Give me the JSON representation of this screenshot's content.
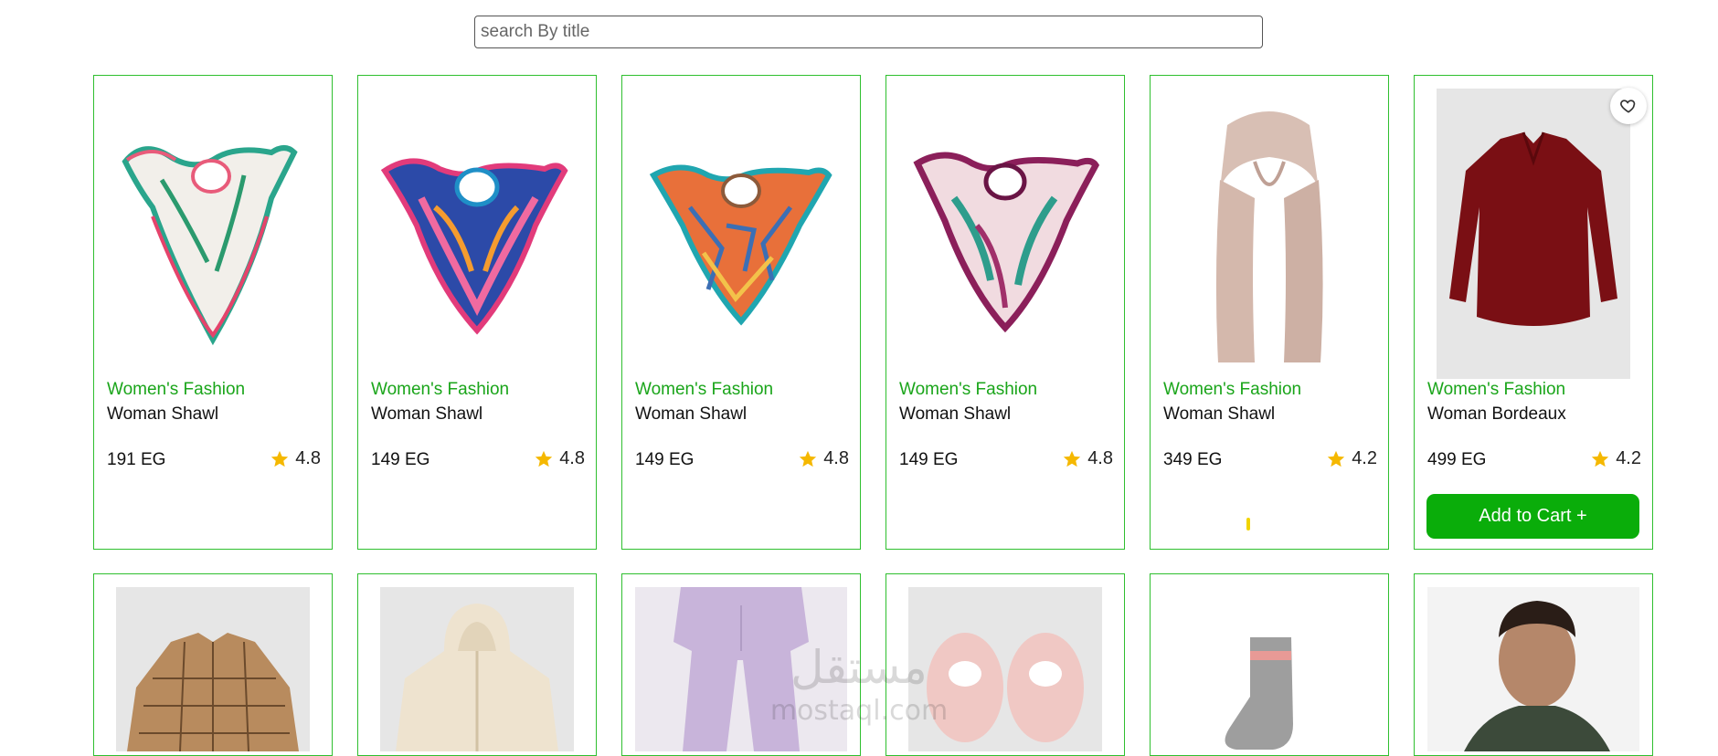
{
  "search": {
    "placeholder": "search By title"
  },
  "products": [
    {
      "category": "Women's Fashion",
      "title": "Woman Shawl",
      "price": "191 EG",
      "rating": "4.8",
      "image": "floral-white-scarf"
    },
    {
      "category": "Women's Fashion",
      "title": "Woman Shawl",
      "price": "149 EG",
      "rating": "4.8",
      "image": "blue-pink-scarf"
    },
    {
      "category": "Women's Fashion",
      "title": "Woman Shawl",
      "price": "149 EG",
      "rating": "4.8",
      "image": "orange-teal-scarf"
    },
    {
      "category": "Women's Fashion",
      "title": "Woman Shawl",
      "price": "149 EG",
      "rating": "4.8",
      "image": "plum-floral-scarf"
    },
    {
      "category": "Women's Fashion",
      "title": "Woman Shawl",
      "price": "349 EG",
      "rating": "4.2",
      "image": "beige-long-shawl"
    },
    {
      "category": "Women's Fashion",
      "title": "Woman Bordeaux",
      "price": "499 EG",
      "rating": "4.2",
      "image": "bordeaux-blouse",
      "add_to_cart_label": "Add to Cart +"
    }
  ],
  "products_row2_images": [
    "plaid-shirt",
    "cream-hoodie",
    "lilac-joggers",
    "pink-slippers",
    "grey-sock",
    "man-tshirt"
  ],
  "colors": {
    "accent_green": "#0aad0a",
    "category_green": "#1aa51a",
    "card_border": "#2fbf2f",
    "star": "#f5b800"
  },
  "watermark": {
    "arabic": "مستقل",
    "latin": "mostaql.com"
  }
}
